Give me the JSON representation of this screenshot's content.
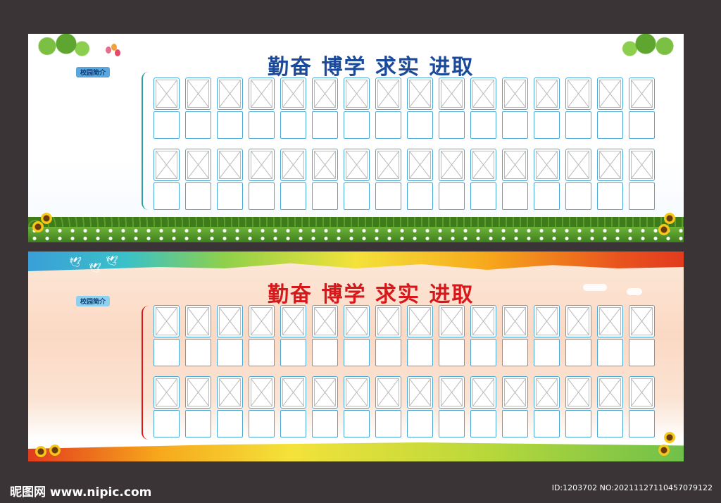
{
  "boards": [
    {
      "title": "勤奋 博学 求实 进取",
      "tag": "校园简介",
      "rows": 2,
      "columns": 16
    },
    {
      "title": "勤奋 博学 求实 进取",
      "tag": "校园简介",
      "rows": 2,
      "columns": 16
    }
  ],
  "footer": {
    "watermark": "昵图网 www.nipic.com",
    "id_text": "ID:1203702 NO:20211127110457079122"
  },
  "colors": {
    "background": "#3a3436",
    "board1_title": "#1b4a9a",
    "board2_title": "#d8171b",
    "frame_border": "#4aa9d6"
  }
}
